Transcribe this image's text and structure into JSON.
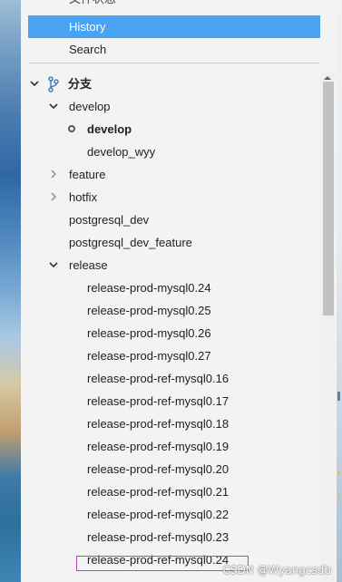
{
  "nav": {
    "items": [
      {
        "label": "文件状态"
      },
      {
        "label": "History"
      },
      {
        "label": "Search"
      }
    ]
  },
  "tree": {
    "root": {
      "label": "分支"
    },
    "groups": [
      {
        "label": "develop",
        "children": [
          {
            "label": "develop",
            "current": true
          },
          {
            "label": "develop_wyy"
          }
        ]
      },
      {
        "label": "feature"
      },
      {
        "label": "hotfix"
      },
      {
        "label": "postgresql_dev"
      },
      {
        "label": "postgresql_dev_feature"
      },
      {
        "label": "release",
        "children": [
          {
            "label": "release-prod-mysql0.24"
          },
          {
            "label": "release-prod-mysql0.25"
          },
          {
            "label": "release-prod-mysql0.26"
          },
          {
            "label": "release-prod-mysql0.27"
          },
          {
            "label": "release-prod-ref-mysql0.16"
          },
          {
            "label": "release-prod-ref-mysql0.17"
          },
          {
            "label": "release-prod-ref-mysql0.18"
          },
          {
            "label": "release-prod-ref-mysql0.19"
          },
          {
            "label": "release-prod-ref-mysql0.20"
          },
          {
            "label": "release-prod-ref-mysql0.21"
          },
          {
            "label": "release-prod-ref-mysql0.22"
          },
          {
            "label": "release-prod-ref-mysql0.23"
          },
          {
            "label": "release-prod-ref-mysql0.24"
          }
        ]
      }
    ]
  },
  "watermark": "CSDN @Wyangcsdb",
  "colors": {
    "active_nav": "#4aa3f2",
    "highlight_box": "#b04ab8"
  }
}
